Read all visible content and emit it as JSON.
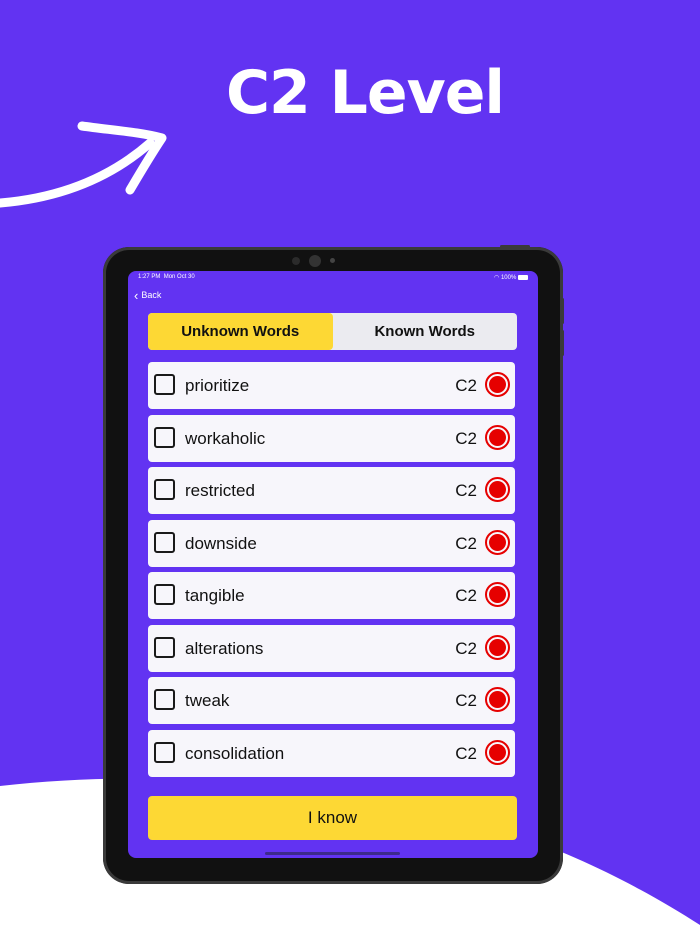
{
  "headline": "C2 Level",
  "colors": {
    "background": "#6233f2",
    "accent": "#fdd834",
    "record": "#e60000",
    "row": "#f7f6fb"
  },
  "status_bar": {
    "time": "1:27 PM",
    "date": "Mon Oct 30",
    "battery": "100%"
  },
  "nav": {
    "back_label": "Back"
  },
  "tabs": [
    {
      "label": "Unknown Words",
      "active": true
    },
    {
      "label": "Known Words",
      "active": false
    }
  ],
  "words": [
    {
      "word": "prioritize",
      "level": "C2"
    },
    {
      "word": "workaholic",
      "level": "C2"
    },
    {
      "word": "restricted",
      "level": "C2"
    },
    {
      "word": "downside",
      "level": "C2"
    },
    {
      "word": "tangible",
      "level": "C2"
    },
    {
      "word": "alterations",
      "level": "C2"
    },
    {
      "word": "tweak",
      "level": "C2"
    },
    {
      "word": "consolidation",
      "level": "C2"
    }
  ],
  "action": {
    "label": "I know"
  }
}
